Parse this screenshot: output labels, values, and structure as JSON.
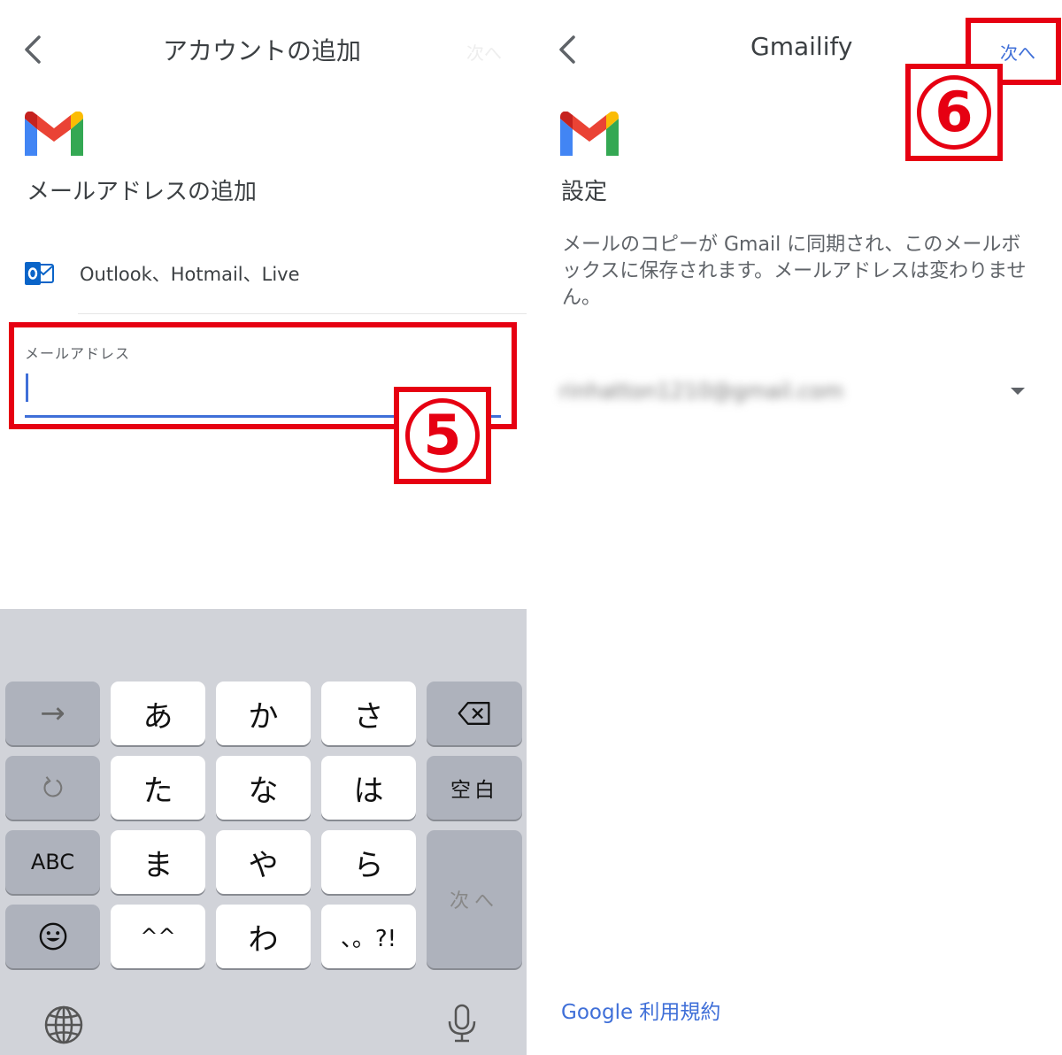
{
  "left": {
    "title": "アカウントの追加",
    "next_faded": "次へ",
    "heading": "メールアドレスの追加",
    "provider": "Outlook、Hotmail、Live",
    "email_label": "メールアドレス",
    "email_value": "",
    "step_badge": "5"
  },
  "keyboard": {
    "row1": [
      "→",
      "あ",
      "か",
      "さ"
    ],
    "row2": [
      "た",
      "な",
      "は",
      "空白"
    ],
    "row3": [
      "ABC",
      "ま",
      "や",
      "ら"
    ],
    "row4": [
      "^^",
      "わ",
      "、。?!"
    ],
    "next_key": "次へ"
  },
  "right": {
    "title": "Gmailify",
    "next_button": "次へ",
    "heading": "設定",
    "description": "メールのコピーが Gmail に同期され、このメールボックスに保存されます。メールアドレスは変わりません。",
    "account_email": "rinhatton1210@gmail.com",
    "terms_link": "Google 利用規約",
    "step_badge": "6"
  },
  "colors": {
    "accent_blue": "#3f6fd8",
    "annotation_red": "#e60012",
    "keyboard_bg": "#d1d3d9",
    "func_key": "#aeb2bc"
  },
  "icons": [
    "back-arrow-icon",
    "gmail-logo-icon",
    "outlook-icon",
    "backspace-icon",
    "undo-icon",
    "emoji-icon",
    "globe-icon",
    "microphone-icon",
    "dropdown-caret-icon"
  ]
}
